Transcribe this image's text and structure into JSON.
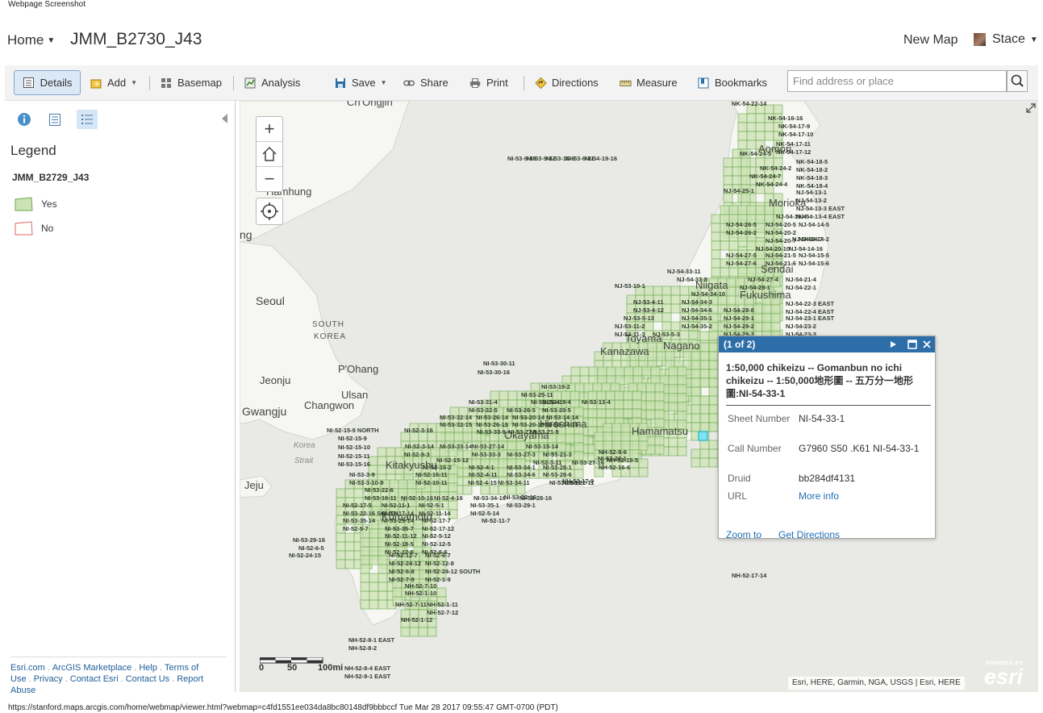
{
  "page_caption": "Webpage Screenshot",
  "header": {
    "home_label": "Home",
    "map_title": "JMM_B2730_J43",
    "new_map_label": "New Map",
    "user_name": "Stace"
  },
  "toolbar": {
    "details": "Details",
    "add": "Add",
    "basemap": "Basemap",
    "analysis": "Analysis",
    "save": "Save",
    "share": "Share",
    "print": "Print",
    "directions": "Directions",
    "measure": "Measure",
    "bookmarks": "Bookmarks",
    "search_placeholder": "Find address or place"
  },
  "sidebar": {
    "legend_title": "Legend",
    "layer_name": "JMM_B2729_J43",
    "legend_items": [
      {
        "label": "Yes",
        "fill": "#cde3b6",
        "stroke": "#6aa84f"
      },
      {
        "label": "No",
        "fill": "#ffffff",
        "stroke": "#e06666"
      }
    ],
    "footer_links": [
      "Esri.com",
      "ArcGIS Marketplace",
      "Help",
      "Terms of Use",
      "Privacy",
      "Contact Esri",
      "Contact Us",
      "Report Abuse"
    ]
  },
  "map": {
    "place_labels": {
      "hamhung": "Hamhung",
      "seoul": "Seoul",
      "south_korea_1": "SOUTH",
      "south_korea_2": "KOREA",
      "pohang": "P'Ohang",
      "jeonju": "Jeonju",
      "ulsan": "Ulsan",
      "changwon": "Changwon",
      "gwangju": "Gwangju",
      "jeju": "Jeju",
      "korea_strait_1": "Korea",
      "korea_strait_2": "Strait",
      "chongjin": "Ch'Ongjin",
      "ng": "ng",
      "aomori": "Aomori",
      "morioka": "Morioka",
      "sendai": "Sendai",
      "niigata": "Niigata",
      "fukushima": "Fukushima",
      "kanazawa": "Kanazawa",
      "toyama": "Toyama",
      "nagano": "Nagano",
      "hamamatsu": "Hamamatsu",
      "okayama": "Okayama",
      "kitakyushu": "Kitakyushu",
      "kumamoto": "Kumamoto",
      "hiroshima": "Hiroshima"
    },
    "sheet_labels": [
      "NK-54-22-14",
      "NK-54-16-16",
      "NK-54-17-9",
      "NK-54-17-10",
      "NK-54-17-11",
      "NK-54-17-12",
      "NK-54-24-5",
      "NK-54-18-5",
      "NK-54-24-2",
      "NK-54-18-2",
      "NK-54-24-7",
      "NK-54-18-3",
      "NK-54-24-4",
      "NK-54-18-4",
      "NJ-54-25-1",
      "NJ-54-13-1",
      "NJ-54-13-2",
      "NJ-54-13-3 EAST",
      "NJ-54-13-4 EAST",
      "NJ-54-19-4",
      "NJ-54-26-5",
      "NJ-54-20-5",
      "NJ-54-14-5",
      "NJ-54-26-2",
      "NJ-54-20-2",
      "NJ-54-14-2",
      "NJ-54-20-7",
      "NJ-54-14-7",
      "NJ-54-20-10",
      "NJ-54-14-16",
      "NJ-54-27-5",
      "NJ-54-21-5",
      "NJ-54-15-5",
      "NJ-54-27-6",
      "NJ-54-21-6",
      "NJ-54-15-6",
      "NJ-54-33-11",
      "NJ-54-33-8",
      "NJ-54-27-4",
      "NJ-54-21-4",
      "NJ-53-10-1",
      "NJ-54-28-1",
      "NJ-54-22-1",
      "NJ-54-34-10",
      "NJ-54-22-3 EAST",
      "NJ-53-4-11",
      "NJ-54-34-3",
      "NJ-53-4-12",
      "NJ-54-34-6",
      "NJ-54-28-8",
      "NJ-54-22-4 EAST",
      "NJ-53-5-13",
      "NJ-54-35-1",
      "NJ-54-29-1",
      "NJ-54-23-1 EAST",
      "NJ-53-11-2",
      "NJ-54-35-2",
      "NJ-54-29-2",
      "NJ-54-23-2",
      "NJ-53-11-3",
      "NJ-53-5-3",
      "NJ-54-29-3",
      "NJ-54-23-3",
      "NI-53-30-11",
      "NI-53-30-16",
      "NI-53-19-2",
      "NI-53-25-11",
      "NI-53-31-4",
      "NI-53-25-4",
      "NI-53-19-4",
      "NI-53-13-4",
      "NI-53-32-5",
      "NI-53-26-5",
      "NI-53-20-5",
      "NI-53-32-14",
      "NI-53-26-14",
      "NI-53-20-14",
      "NI-53-14-14",
      "NI-53-32-15",
      "NI-53-26-15",
      "NI-53-20-15",
      "NI-53-14-15",
      "NI-52-15-9 NORTH",
      "NI-52-3-16",
      "NI-53-33-9",
      "NI-53-27-9",
      "NI-53-21-9",
      "NI-52-15-9",
      "NI-52-3-14",
      "NI-53-33-14",
      "NI-53-27-14",
      "NI-53-15-14",
      "NI-52-15-10",
      "NI-52-15-11",
      "NI-52-9-3",
      "NI-53-33-3",
      "NI-53-27-3",
      "NI-53-21-3",
      "NI-53-15-16",
      "NI-52-15-12",
      "NI-52-3-11",
      "NI-53-27-16",
      "NI-53-3-9",
      "NI-52-16-2",
      "NI-52-4-1",
      "NI-53-34-1",
      "NI-53-28-1",
      "NI-53-22-1",
      "NI-53-3-10-9",
      "NI-52-16-11",
      "NI-52-4-11",
      "NI-53-34-6",
      "NI-53-28-6",
      "NI-53-22-6",
      "NI-52-10-11",
      "NI-52-4-15",
      "NI-53-34-11",
      "NI-53-28-11",
      "NI-53-22-11",
      "NI-53-16-11",
      "NI-52-10-16",
      "NI-52-4-16",
      "NI-53-34-16",
      "NI-53-28-16",
      "NI-53-22-16",
      "NI-52-17-5",
      "NI-52-11-1",
      "NI-52-5-1",
      "NI-53-35-1",
      "NI-53-29-1",
      "NI-53-22-16 SOUTH",
      "NI-52-17-14",
      "NI-52-11-14",
      "NI-52-5-14",
      "NI-53-35-14",
      "NI-53-29-14",
      "NI-52-17-7",
      "NI-52-11-7",
      "NI-52-5-7",
      "NI-53-35-7",
      "NI-52-17-12",
      "NI-52-11-12",
      "NI-52-5-12",
      "NI-53-29-16",
      "NI-52-18-5",
      "NI-52-12-5",
      "NI-52-6-5",
      "NI-52-12-6",
      "NI-52-6-6",
      "NI-52-24-15",
      "NI-52-12-7",
      "NI-52-6-7",
      "NI-52-24-12",
      "NI-52-12-8",
      "NI-52-6-8",
      "NI-52-24-12 SOUTH",
      "NI-52-7-9",
      "NI-52-1-9",
      "NH-52-7-10",
      "NH-52-1-10",
      "NH-52-7-11",
      "NH-52-1-11",
      "NH-52-7-12",
      "NH-52-1-12",
      "NH-52-8-1 EAST",
      "NH-52-8-2",
      "NH-52-8-4 EAST",
      "NH-52-9-1 EAST",
      "NH-52-9-6",
      "NH-52-16-5",
      "NH-52-16-6",
      "NH-52-17-9",
      "NH-52-17-14",
      "NI-53-9-15",
      "NI-53-9-12",
      "NI-53-10-9",
      "NI-53-6-11",
      "NI-54-19-16"
    ],
    "scale_labels": [
      "0",
      "50",
      "100mi"
    ],
    "attribution": "Esri, HERE, Garmin, NGA, USGS | Esri, HERE",
    "esri_powered": "POWERED BY",
    "esri_brand": "esri"
  },
  "popup": {
    "counter": "(1 of 2)",
    "title": "1:50,000 chikeizu -- Gomanbun no ichi chikeizu -- 1:50,000地形圖 -- 五万分一地形圖:NI-54-33-1",
    "fields": [
      {
        "label": "Sheet Number",
        "value": "NI-54-33-1"
      },
      {
        "label": "Call Number",
        "value": "G7960 S50 .K61 NI-54-33-1"
      },
      {
        "label": "Druid",
        "value": "bb284df4131"
      },
      {
        "label": "URL",
        "value": "More info"
      }
    ],
    "zoom_to": "Zoom to",
    "get_directions": "Get Directions"
  },
  "status_url": "https://stanford.maps.arcgis.com/home/webmap/viewer.html?webmap=c4fd1551ee034da8bc80148df9bbbccf Tue Mar 28 2017 09:55:47 GMT-0700 (PDT)",
  "colors": {
    "accent": "#2d6ea8",
    "grid_fill": "#cde3b6",
    "grid_stroke": "#6aa84f"
  }
}
